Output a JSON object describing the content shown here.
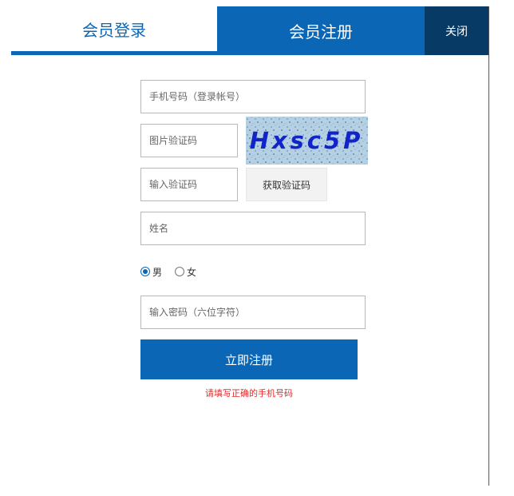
{
  "tabs": {
    "login_label": "会员登录",
    "register_label": "会员注册",
    "close_label": "关闭"
  },
  "form": {
    "phone_placeholder": "手机号码（登录帐号）",
    "image_code_placeholder": "图片验证码",
    "captcha_text": "Hxsc5P",
    "sms_code_placeholder": "输入验证码",
    "get_code_label": "获取验证码",
    "name_placeholder": "姓名",
    "gender": {
      "male_label": "男",
      "female_label": "女",
      "selected": "男"
    },
    "password_placeholder": "输入密码（六位字符）",
    "submit_label": "立即注册",
    "error_message": "请填写正确的手机号码"
  },
  "colors": {
    "primary": "#0b67b6",
    "dark": "#083a66",
    "error": "#e22b2b",
    "captcha_text": "#1024c8"
  }
}
